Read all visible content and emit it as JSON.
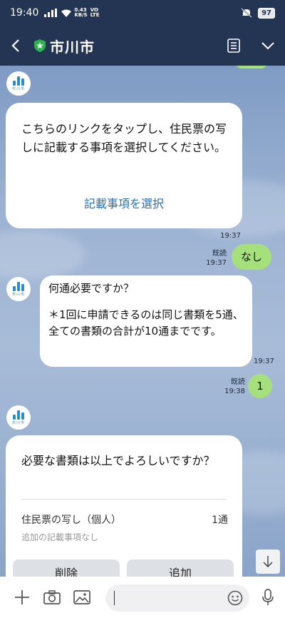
{
  "status_bar": {
    "time": "19:40",
    "net_speed": "0.43",
    "net_unit": "KB/S",
    "volte": "VO",
    "lte": "LTE",
    "battery": "97"
  },
  "header": {
    "title": "市川市"
  },
  "avatar": {
    "label": "市川市"
  },
  "messages": {
    "card1": {
      "text": "こちらのリンクをタップし、住民票の写しに記載する事項を選択してください。",
      "link": "記載事項を選択",
      "time": "19:37"
    },
    "reply1": {
      "read": "既読",
      "time": "19:37",
      "text": "なし"
    },
    "bubble2": {
      "line1": "何通必要ですか？",
      "line2": "＊1回に申請できるのは同じ書類を5通、全ての書類の合計が10通までです。",
      "time": "19:37"
    },
    "reply2": {
      "read": "既読",
      "time": "19:38",
      "text": "1"
    },
    "card2": {
      "text": "必要な書類は以上でよろしいですか？",
      "item_name": "住民票の写し（個人）",
      "item_count": "1通",
      "item_sub": "追加の記載事項なし",
      "btn_delete": "削除",
      "btn_add": "追加"
    }
  },
  "colors": {
    "header_bg": "#243453",
    "outgoing_bubble": "#a6e07d",
    "link": "#2a6fb0",
    "brand_shield": "#2bb24c"
  }
}
